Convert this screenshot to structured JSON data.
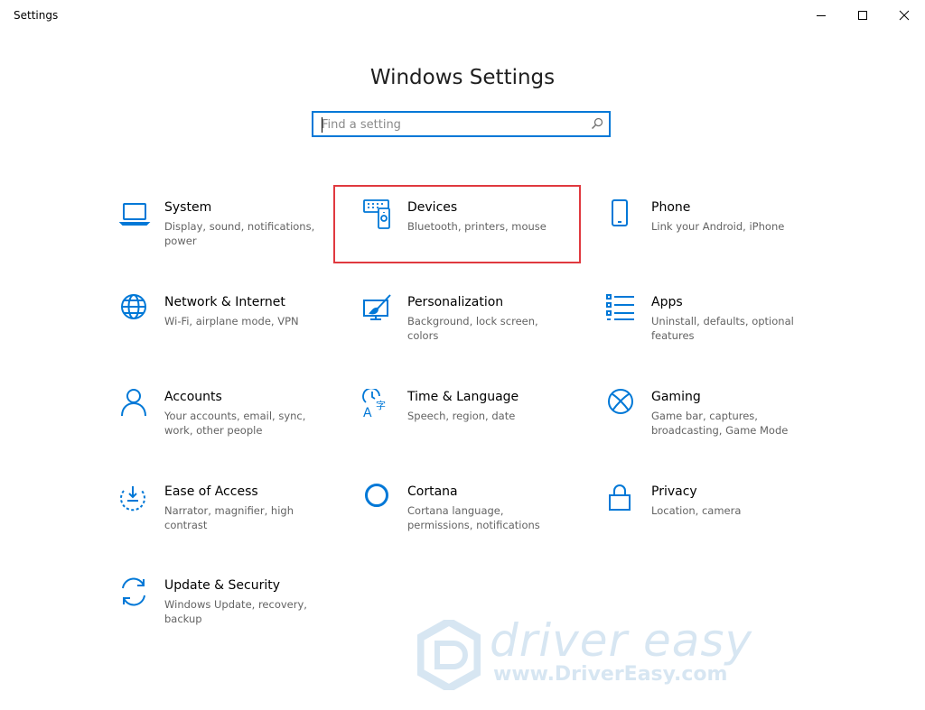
{
  "window": {
    "title": "Settings"
  },
  "header": {
    "title": "Windows Settings"
  },
  "search": {
    "placeholder": "Find a setting"
  },
  "accent": "#0078d7",
  "highlight_color": "#e0393f",
  "tiles": [
    {
      "title": "System",
      "desc": "Display, sound, notifications, power",
      "icon": "laptop-icon"
    },
    {
      "title": "Devices",
      "desc": "Bluetooth, printers, mouse",
      "icon": "devices-icon"
    },
    {
      "title": "Phone",
      "desc": "Link your Android, iPhone",
      "icon": "phone-icon"
    },
    {
      "title": "Network & Internet",
      "desc": "Wi-Fi, airplane mode, VPN",
      "icon": "globe-icon"
    },
    {
      "title": "Personalization",
      "desc": "Background, lock screen, colors",
      "icon": "personalization-icon"
    },
    {
      "title": "Apps",
      "desc": "Uninstall, defaults, optional features",
      "icon": "apps-list-icon"
    },
    {
      "title": "Accounts",
      "desc": "Your accounts, email, sync, work, other people",
      "icon": "person-icon"
    },
    {
      "title": "Time & Language",
      "desc": "Speech, region, date",
      "icon": "time-language-icon"
    },
    {
      "title": "Gaming",
      "desc": "Game bar, captures, broadcasting, Game Mode",
      "icon": "xbox-icon"
    },
    {
      "title": "Ease of Access",
      "desc": "Narrator, magnifier, high contrast",
      "icon": "ease-of-access-icon"
    },
    {
      "title": "Cortana",
      "desc": "Cortana language, permissions, notifications",
      "icon": "cortana-icon"
    },
    {
      "title": "Privacy",
      "desc": "Location, camera",
      "icon": "lock-icon"
    },
    {
      "title": "Update & Security",
      "desc": "Windows Update, recovery, backup",
      "icon": "sync-icon"
    }
  ],
  "watermark": {
    "name": "driver easy",
    "url": "www.DriverEasy.com"
  }
}
